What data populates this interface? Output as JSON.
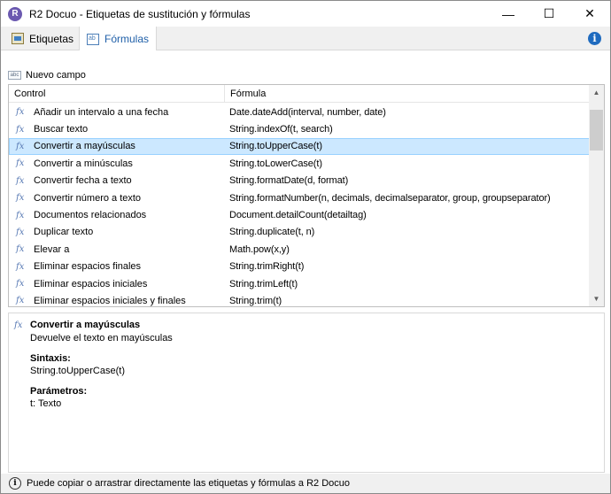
{
  "window": {
    "title": "R2 Docuo - Etiquetas de sustitución y fórmulas",
    "app_icon": "r2-docuo-logo-icon",
    "minimize_glyph": "—",
    "maximize_glyph": "☐",
    "close_glyph": "✕"
  },
  "tabs": [
    {
      "label": "Etiquetas",
      "icon": "tags-icon",
      "active": false
    },
    {
      "label": "Fórmulas",
      "icon": "formulas-icon",
      "active": true
    }
  ],
  "info_glyph": "i",
  "new_field": {
    "label": "Nuevo campo",
    "icon_text": "abc"
  },
  "list": {
    "columns": [
      "Control",
      "Fórmula"
    ],
    "fx_glyph": "fx",
    "rows": [
      {
        "name": "Añadir un intervalo a una fecha",
        "formula": "Date.dateAdd(interval, number, date)"
      },
      {
        "name": "Buscar texto",
        "formula": "String.indexOf(t, search)"
      },
      {
        "name": "Convertir a mayúsculas",
        "formula": "String.toUpperCase(t)",
        "selected": true
      },
      {
        "name": "Convertir a minúsculas",
        "formula": "String.toLowerCase(t)"
      },
      {
        "name": "Convertir fecha a texto",
        "formula": "String.formatDate(d, format)"
      },
      {
        "name": "Convertir número a texto",
        "formula": "String.formatNumber(n, decimals, decimalseparator, group, groupseparator)"
      },
      {
        "name": "Documentos relacionados",
        "formula": "Document.detailCount(detailtag)"
      },
      {
        "name": "Duplicar texto",
        "formula": "String.duplicate(t, n)"
      },
      {
        "name": "Elevar a",
        "formula": "Math.pow(x,y)"
      },
      {
        "name": "Eliminar espacios finales",
        "formula": "String.trimRight(t)"
      },
      {
        "name": "Eliminar espacios iniciales",
        "formula": "String.trimLeft(t)"
      },
      {
        "name": "Eliminar espacios iniciales y finales",
        "formula": "String.trim(t)"
      }
    ]
  },
  "detail": {
    "title": "Convertir a mayúsculas",
    "description": "Devuelve el texto en mayúsculas",
    "syntax_label": "Sintaxis:",
    "syntax_value": "String.toUpperCase(t)",
    "params_label": "Parámetros:",
    "params_value": "t: Texto"
  },
  "status": {
    "text": "Puede copiar o arrastrar directamente las etiquetas y fórmulas a R2 Docuo",
    "glyph": "i"
  }
}
